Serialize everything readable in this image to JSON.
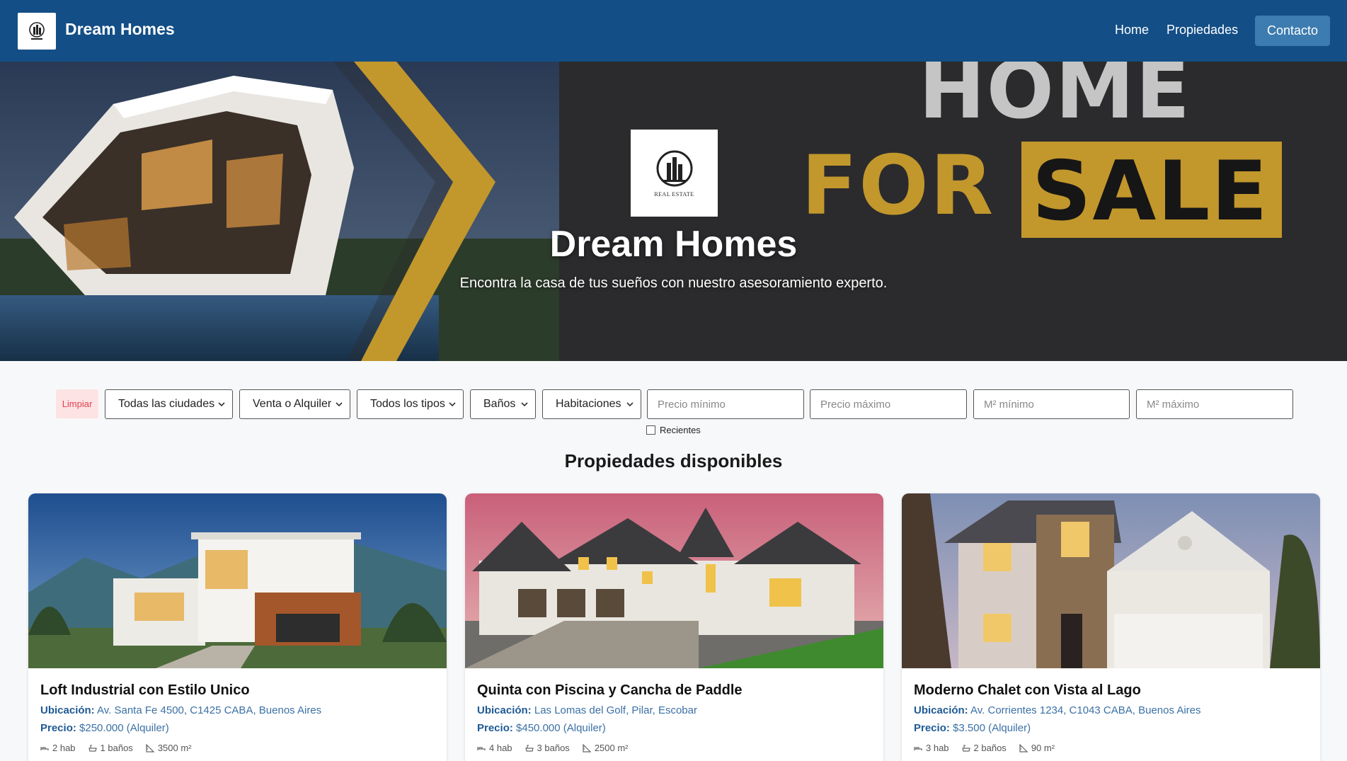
{
  "navbar": {
    "brand": "Dream Homes",
    "links": [
      "Home",
      "Propiedades"
    ],
    "contact": "Contacto"
  },
  "hero": {
    "title": "Dream Homes",
    "subtitle": "Encontra la casa de tus sueños con nuestro asesoramiento experto.",
    "banner_word_1": "HOME",
    "banner_word_2": "FOR",
    "banner_word_3": "SALE",
    "logo_text": "REAL ESTATE"
  },
  "filters": {
    "clear": "Limpiar",
    "city": "Todas las ciudades",
    "operation": "Venta o Alquiler",
    "type": "Todos los tipos",
    "baths": "Baños",
    "rooms": "Habitaciones",
    "price_min_placeholder": "Precio mínimo",
    "price_max_placeholder": "Precio máximo",
    "m2_min_placeholder": "M² mínimo",
    "m2_max_placeholder": "M² máximo",
    "recent_label": "Recientes"
  },
  "section_title": "Propiedades disponibles",
  "labels": {
    "location": "Ubicación:",
    "price": "Precio:"
  },
  "properties": [
    {
      "title": "Loft Industrial con Estilo Unico",
      "location": "Av. Santa Fe 4500, C1425 CABA, Buenos Aires",
      "price": "$250.000 (Alquiler)",
      "rooms": "2 hab",
      "baths": "1 baños",
      "area": "3500 m²"
    },
    {
      "title": "Quinta con Piscina y Cancha de Paddle",
      "location": "Las Lomas del Golf, Pilar, Escobar",
      "price": "$450.000 (Alquiler)",
      "rooms": "4 hab",
      "baths": "3 baños",
      "area": "2500 m²"
    },
    {
      "title": "Moderno Chalet con Vista al Lago",
      "location": "Av. Corrientes 1234, C1043 CABA, Buenos Aires",
      "price": "$3.500 (Alquiler)",
      "rooms": "3 hab",
      "baths": "2 baños",
      "area": "90 m²"
    }
  ],
  "colors": {
    "navbar": "#134e86",
    "contact_button": "#3d7cb0",
    "gold": "#c2972c",
    "link_blue": "#3b70a5"
  }
}
